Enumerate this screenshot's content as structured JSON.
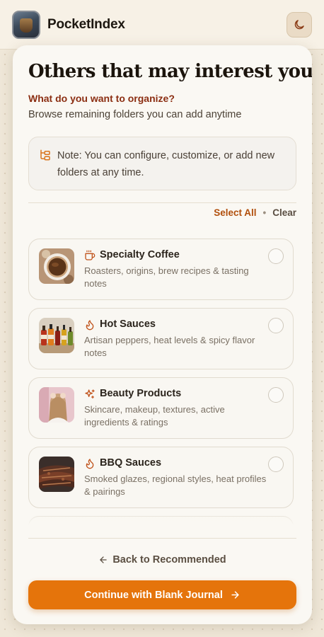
{
  "header": {
    "app_name": "PocketIndex",
    "theme_icon": "moon-icon"
  },
  "main": {
    "title": "Others that may interest you",
    "question": "What do you want to organize?",
    "subtitle": "Browse remaining folders you can add anytime",
    "note": {
      "icon": "folder-tree-icon",
      "text": "Note: You can configure, customize, or add new folders at any time."
    },
    "actions": {
      "select_all": "Select All",
      "separator": "•",
      "clear": "Clear"
    },
    "folders": [
      {
        "title": "Specialty Coffee",
        "description": "Roasters, origins, brew recipes & tasting notes",
        "icon": "coffee-cup-icon",
        "checked": false
      },
      {
        "title": "Hot Sauces",
        "description": "Artisan peppers, heat levels & spicy flavor notes",
        "icon": "flame-icon",
        "checked": false
      },
      {
        "title": "Beauty Products",
        "description": "Skincare, makeup, textures, active ingredients & ratings",
        "icon": "sparkles-icon",
        "checked": false
      },
      {
        "title": "BBQ Sauces",
        "description": "Smoked glazes, regional styles, heat profiles & pairings",
        "icon": "flame-icon",
        "checked": false
      }
    ],
    "back_label": "Back to Recommended",
    "continue_label": "Continue with Blank Journal"
  },
  "colors": {
    "accent": "#e5740b",
    "accent_text": "#b14f0c",
    "question_text": "#8b2e12",
    "page_background": "#efe7d8",
    "card_background": "#faf8f3"
  }
}
